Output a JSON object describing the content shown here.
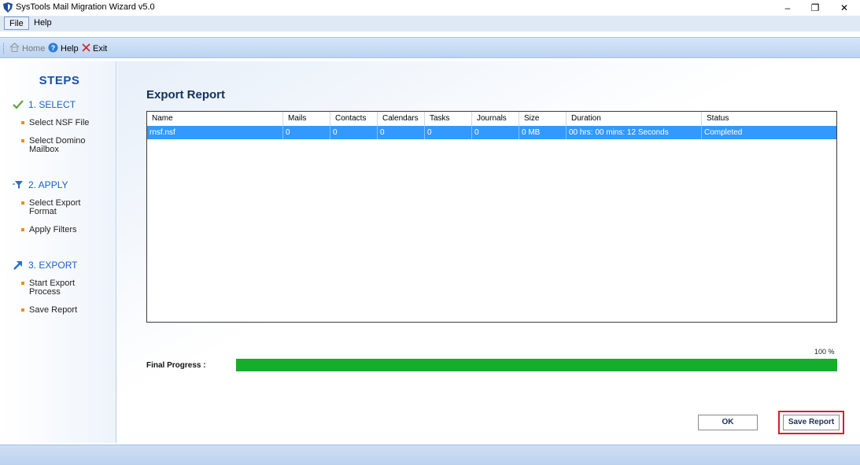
{
  "window": {
    "title": "SysTools Mail Migration Wizard v5.0",
    "controls": {
      "minimize": "–",
      "maximize": "❐",
      "close": "✕"
    }
  },
  "menu": {
    "items": [
      "File",
      "Help"
    ]
  },
  "toolbar": {
    "home_label": "Home",
    "help_label": "Help",
    "exit_label": "Exit"
  },
  "sidebar": {
    "title": "STEPS",
    "steps": [
      {
        "label": "1. SELECT",
        "icon": "check-icon",
        "substeps": [
          "Select NSF File",
          "Select Domino\nMailbox"
        ]
      },
      {
        "label": "2. APPLY",
        "icon": "filter-icon",
        "substeps": [
          "Select Export\nFormat",
          "Apply Filters"
        ]
      },
      {
        "label": "3. EXPORT",
        "icon": "export-arrow-icon",
        "substeps": [
          "Start Export\nProcess",
          "Save Report"
        ]
      }
    ]
  },
  "main": {
    "heading": "Export Report",
    "table": {
      "columns": [
        "Name",
        "Mails",
        "Contacts",
        "Calendars",
        "Tasks",
        "Journals",
        "Size",
        "Duration",
        "Status"
      ],
      "rows": [
        [
          "rnsf.nsf",
          "0",
          "0",
          "0",
          "0",
          "0",
          "0 MB",
          "00 hrs: 00 mins: 12 Seconds",
          "Completed"
        ]
      ]
    },
    "progress": {
      "label": "Final Progress :",
      "percent_text": "100 %",
      "value": 100
    },
    "buttons": {
      "ok": "OK",
      "save_report": "Save Report"
    }
  },
  "colors": {
    "accent": "#1a62c0",
    "row_selected": "#3399ff",
    "progress_fill": "#14ad2c",
    "highlight_border": "#d3202d",
    "bullet": "#f28a1c"
  }
}
